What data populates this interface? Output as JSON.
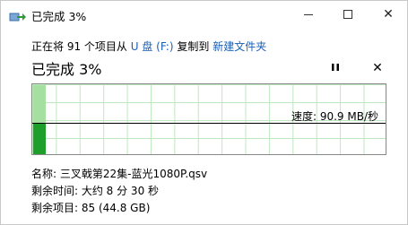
{
  "window": {
    "title": "已完成 3%"
  },
  "copy": {
    "prefix": "正在将 91 个项目从",
    "source": "U 盘 (F:)",
    "middle": "复制到",
    "destination": "新建文件夹"
  },
  "status": {
    "text": "已完成 3%",
    "percent": 3
  },
  "graph": {
    "speed_label": "速度: 90.9 MB/秒"
  },
  "details": {
    "name": "名称: 三叉戟第22集-蓝光1080P.qsv",
    "time_remaining": "剩余时间: 大约 8 分 30 秒",
    "items_remaining": "剩余项目: 85 (44.8 GB)"
  },
  "colors": {
    "link": "#1a5fb4",
    "progress_fill": "#bfeebf",
    "graph_bar": "#1e9e2a"
  }
}
